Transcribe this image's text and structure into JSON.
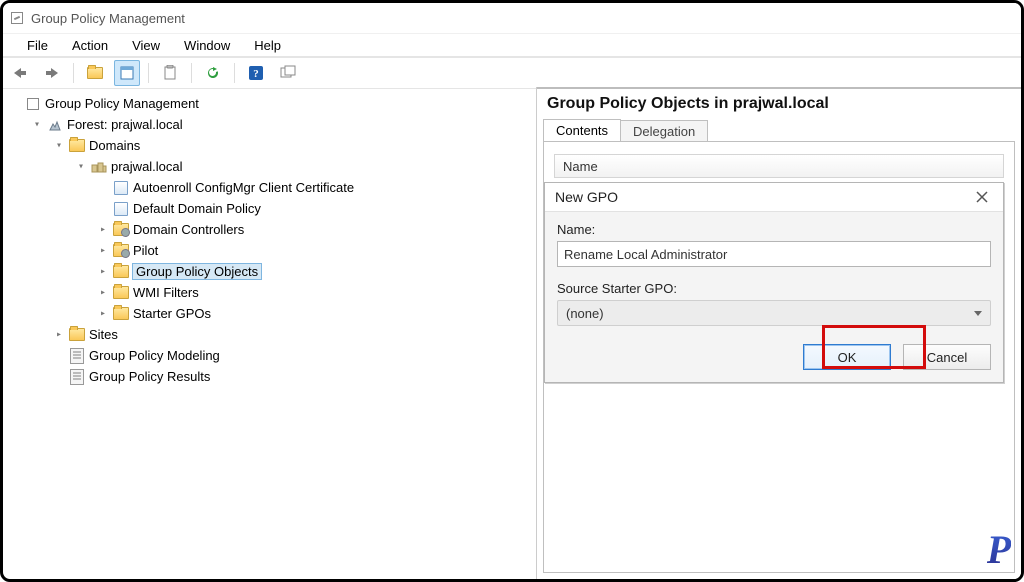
{
  "window_title": "Group Policy Management",
  "menus": [
    "File",
    "Action",
    "View",
    "Window",
    "Help"
  ],
  "toolbar": {
    "back": "Back",
    "fwd": "Forward",
    "up": "Show/Hide Console Tree",
    "props": "Properties",
    "clip": "Export List",
    "refresh": "Refresh",
    "help": "Help",
    "new": "New Window"
  },
  "tree": {
    "root": "Group Policy Management",
    "forest": "Forest: prajwal.local",
    "domains": "Domains",
    "domain": "prajwal.local",
    "items": [
      "Autoenroll ConfigMgr Client Certificate",
      "Default Domain Policy",
      "Domain Controllers",
      "Pilot",
      "Group Policy Objects",
      "WMI Filters",
      "Starter GPOs"
    ],
    "sites": "Sites",
    "modeling": "Group Policy Modeling",
    "results": "Group Policy Results"
  },
  "right": {
    "heading": "Group Policy Objects in prajwal.local",
    "tabs": [
      "Contents",
      "Delegation"
    ],
    "col_name": "Name"
  },
  "dialog": {
    "title": "New GPO",
    "name_label": "Name:",
    "name_value": "Rename Local Administrator",
    "starter_label": "Source Starter GPO:",
    "starter_value": "(none)",
    "ok": "OK",
    "cancel": "Cancel"
  },
  "brand": "P"
}
